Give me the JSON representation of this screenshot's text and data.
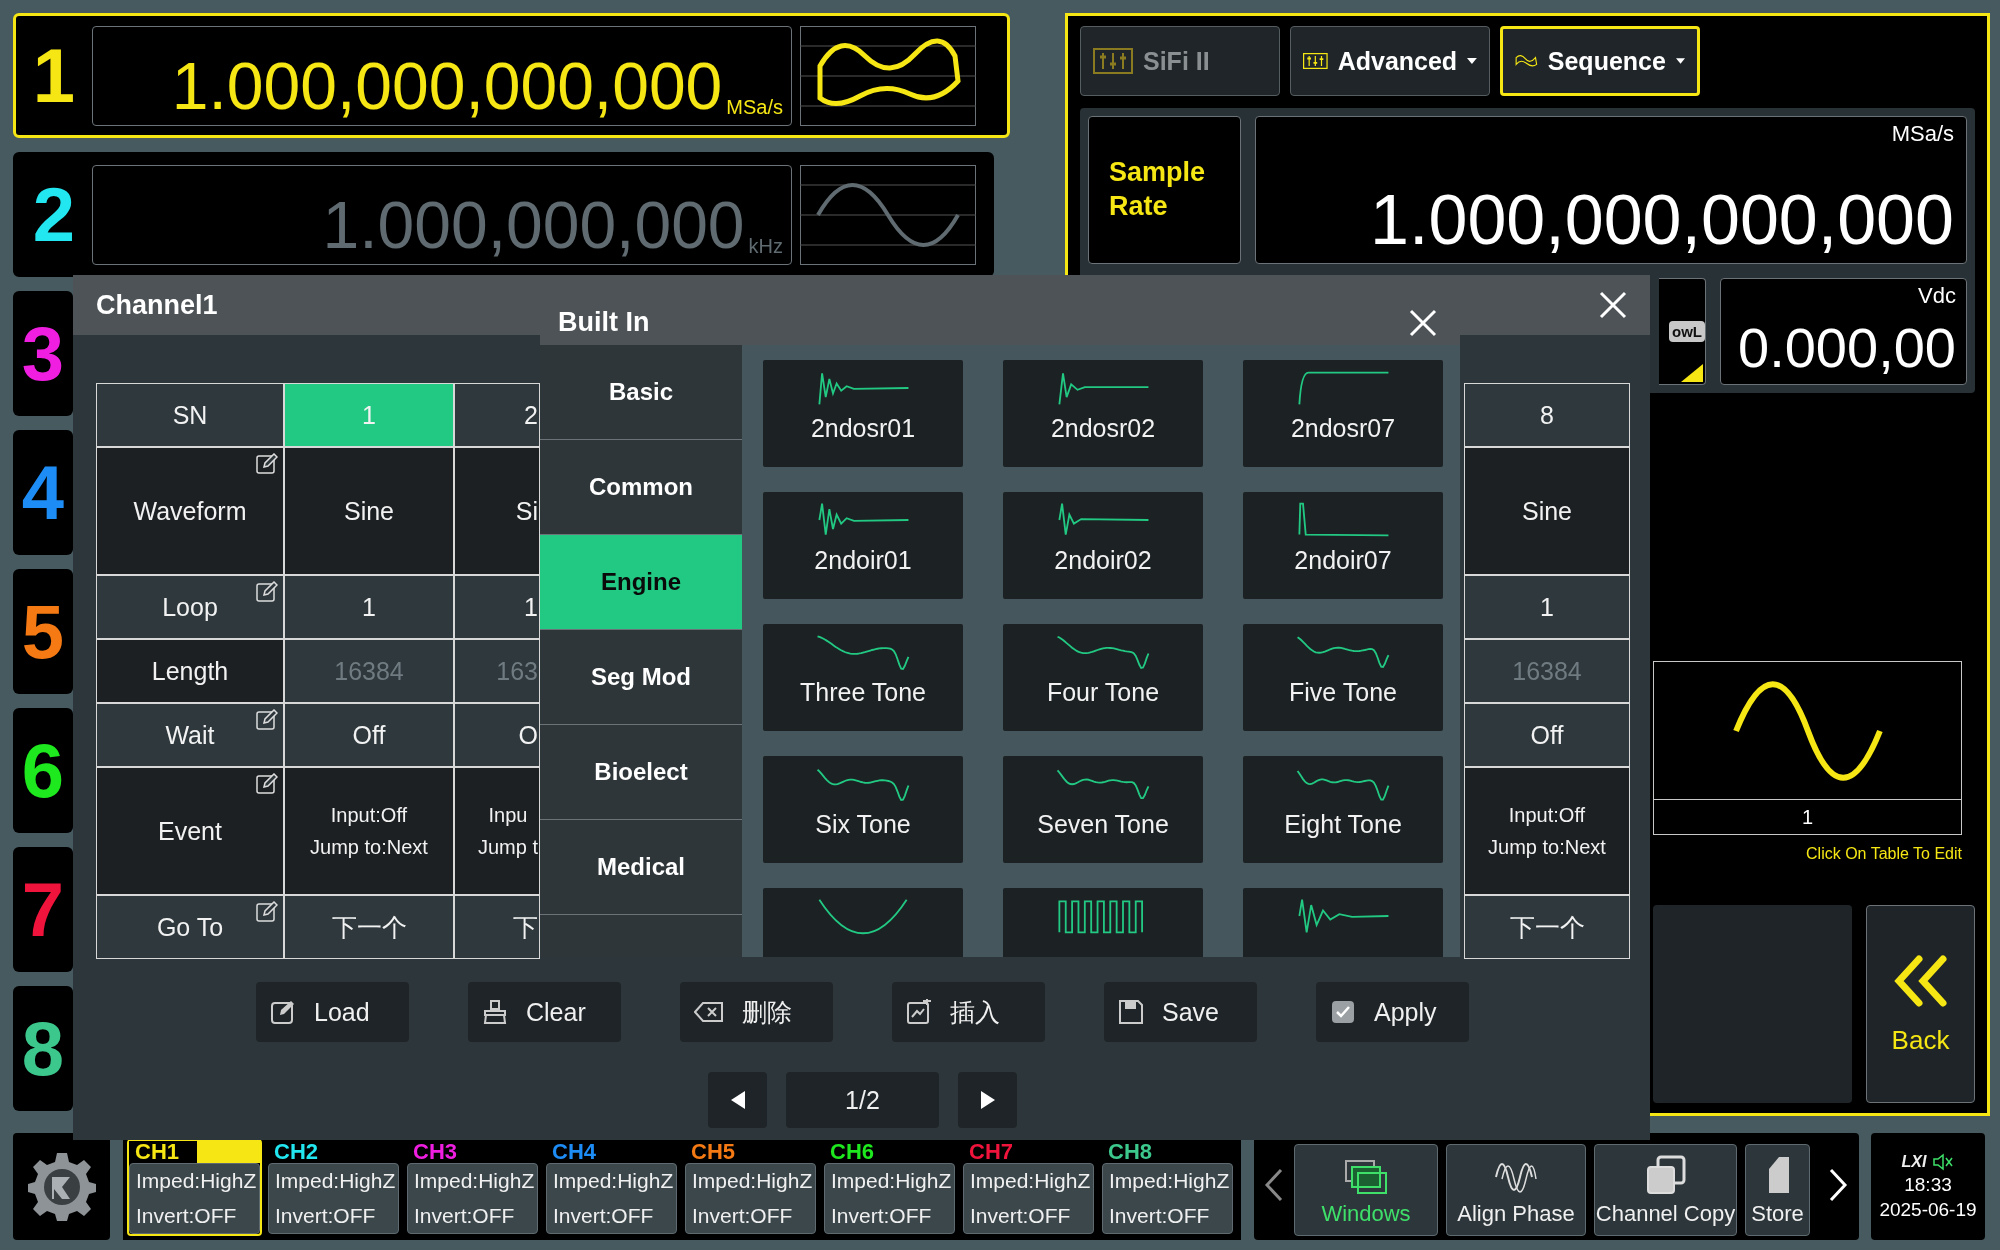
{
  "channels": [
    {
      "number": "1",
      "color": "#f5e614",
      "selected": true,
      "value": "1.000,000,000,000",
      "unit": "MSa/s"
    },
    {
      "number": "2",
      "color": "#22e6f0",
      "selected": false,
      "value": "1.000,000,000",
      "unit": "kHz"
    },
    {
      "number": "3",
      "color": "#f01ee0",
      "selected": false
    },
    {
      "number": "4",
      "color": "#1e8cf5",
      "selected": false
    },
    {
      "number": "5",
      "color": "#f57a14",
      "selected": false
    },
    {
      "number": "6",
      "color": "#1ee81e",
      "selected": false
    },
    {
      "number": "7",
      "color": "#f0143c",
      "selected": false
    },
    {
      "number": "8",
      "color": "#3cc88c",
      "selected": false
    }
  ],
  "mode_tabs": [
    {
      "label": "SiFi II",
      "disabled": true,
      "selected": false,
      "has_menu": false
    },
    {
      "label": "Advanced",
      "disabled": false,
      "selected": false,
      "has_menu": true
    },
    {
      "label": "Sequence",
      "disabled": false,
      "selected": true,
      "has_menu": true
    }
  ],
  "sample_rate": {
    "label": "Sample Rate",
    "unit": "MSa/s",
    "value": "1.000,000,000,000"
  },
  "offset": {
    "badge": "owL",
    "unit": "Vdc",
    "value": "0.000,00"
  },
  "preview": {
    "index": "1",
    "hint": "Click On Table To Edit"
  },
  "back_button": {
    "label": "Back"
  },
  "dialog": {
    "title": "Channel1",
    "table": {
      "row_header": "SN",
      "columns": [
        {
          "header": "1",
          "selected": true
        },
        {
          "header": "2",
          "selected": false
        },
        {
          "header": "8",
          "selected": false
        }
      ],
      "rows": [
        {
          "label": "Waveform",
          "editable": true,
          "disabled": false,
          "cells": [
            "Sine",
            "Si",
            "Sine"
          ]
        },
        {
          "label": "Loop",
          "editable": true,
          "disabled": false,
          "cells": [
            "1",
            "1",
            "1"
          ]
        },
        {
          "label": "Length",
          "editable": false,
          "disabled": true,
          "cells": [
            "16384",
            "163",
            "16384"
          ]
        },
        {
          "label": "Wait",
          "editable": true,
          "disabled": false,
          "cells": [
            "Off",
            "O",
            "Off"
          ]
        },
        {
          "label": "Event",
          "editable": true,
          "disabled": false,
          "cells": [
            "Input:Off\nJump to:Next",
            "Inpu\nJump t",
            "Input:Off\nJump to:Next"
          ]
        },
        {
          "label": "Go To",
          "editable": true,
          "disabled": false,
          "cells": [
            "下一个",
            "下",
            "下一个"
          ]
        }
      ]
    },
    "buttons": [
      {
        "label": "Load"
      },
      {
        "label": "Clear"
      },
      {
        "label": "删除"
      },
      {
        "label": "插入"
      },
      {
        "label": "Save"
      },
      {
        "label": "Apply"
      }
    ],
    "pager": "1/2"
  },
  "built_in": {
    "title": "Built In",
    "categories": [
      {
        "label": "Basic",
        "selected": false
      },
      {
        "label": "Common",
        "selected": false
      },
      {
        "label": "Engine",
        "selected": true
      },
      {
        "label": "Seg Mod",
        "selected": false
      },
      {
        "label": "Bioelect",
        "selected": false
      },
      {
        "label": "Medical",
        "selected": false
      }
    ],
    "waveforms": [
      {
        "kind": "labeled",
        "label": "2ndosr01"
      },
      {
        "kind": "labeled",
        "label": "2ndosr02"
      },
      {
        "kind": "labeled",
        "label": "2ndosr07"
      },
      {
        "kind": "labeled",
        "label": "2ndoir01"
      },
      {
        "kind": "labeled",
        "label": "2ndoir02"
      },
      {
        "kind": "labeled",
        "label": "2ndoir07"
      },
      {
        "kind": "labeled",
        "label": "Three Tone"
      },
      {
        "kind": "labeled",
        "label": "Four Tone"
      },
      {
        "kind": "labeled",
        "label": "Five Tone"
      },
      {
        "kind": "labeled",
        "label": "Six Tone"
      },
      {
        "kind": "labeled",
        "label": "Seven Tone"
      },
      {
        "kind": "labeled",
        "label": "Eight Tone"
      },
      {
        "kind": "unlabeled"
      },
      {
        "kind": "unlabeled"
      },
      {
        "kind": "unlabeled"
      }
    ]
  },
  "channel_chips": [
    {
      "label": "CH1",
      "selected": true,
      "impedance": "Imped:HighZ",
      "invert": "Invert:OFF"
    },
    {
      "label": "CH2",
      "selected": false,
      "impedance": "Imped:HighZ",
      "invert": "Invert:OFF"
    },
    {
      "label": "CH3",
      "selected": false,
      "impedance": "Imped:HighZ",
      "invert": "Invert:OFF"
    },
    {
      "label": "CH4",
      "selected": false,
      "impedance": "Imped:HighZ",
      "invert": "Invert:OFF"
    },
    {
      "label": "CH5",
      "selected": false,
      "impedance": "Imped:HighZ",
      "invert": "Invert:OFF"
    },
    {
      "label": "CH6",
      "selected": false,
      "impedance": "Imped:HighZ",
      "invert": "Invert:OFF"
    },
    {
      "label": "CH7",
      "selected": false,
      "impedance": "Imped:HighZ",
      "invert": "Invert:OFF"
    },
    {
      "label": "CH8",
      "selected": false,
      "impedance": "Imped:HighZ",
      "invert": "Invert:OFF"
    }
  ],
  "toolbar": [
    {
      "label": "Windows",
      "selected": true
    },
    {
      "label": "Align Phase",
      "selected": false
    },
    {
      "label": "Channel Copy",
      "selected": false
    },
    {
      "label": "Store",
      "selected": false
    }
  ],
  "status": {
    "lxi": "LXI",
    "time": "18:33",
    "date": "2025-06-19"
  }
}
